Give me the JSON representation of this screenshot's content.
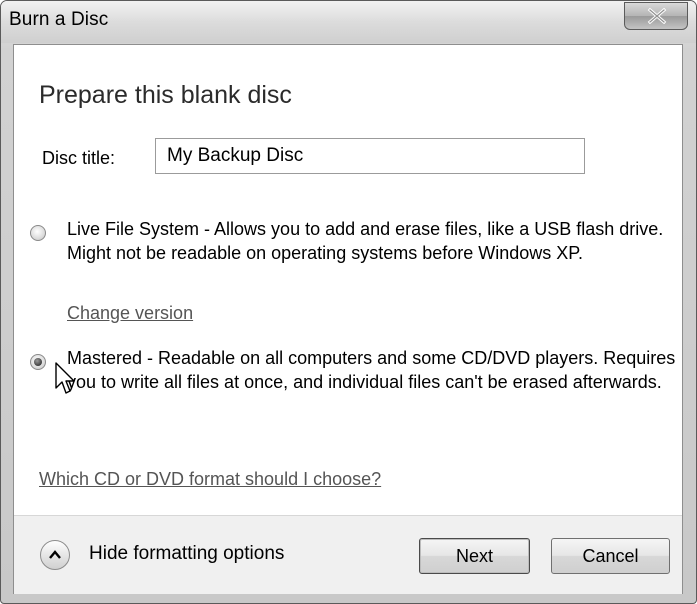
{
  "window": {
    "title": "Burn a Disc",
    "close_label": "X"
  },
  "main": {
    "heading": "Prepare this blank disc",
    "disc_title_label": "Disc title:",
    "disc_title_value": "My Backup Disc",
    "options": [
      {
        "name": "live-file-system",
        "checked": false,
        "text": "Live File System - Allows you to add and erase files, like a USB flash drive. Might not be readable on operating systems before Windows XP.",
        "link": "Change version"
      },
      {
        "name": "mastered",
        "checked": true,
        "text": "Mastered - Readable on all computers and some CD/DVD players. Requires you to write all files at once, and individual files can't be erased afterwards."
      }
    ],
    "help_link": "Which CD or DVD format should I choose?"
  },
  "footer": {
    "toggle_label": "Hide formatting options",
    "next_label": "Next",
    "cancel_label": "Cancel"
  },
  "icons": {
    "close": "close-icon",
    "toggle": "chevron-up-icon",
    "cursor": "mouse-pointer-icon"
  }
}
